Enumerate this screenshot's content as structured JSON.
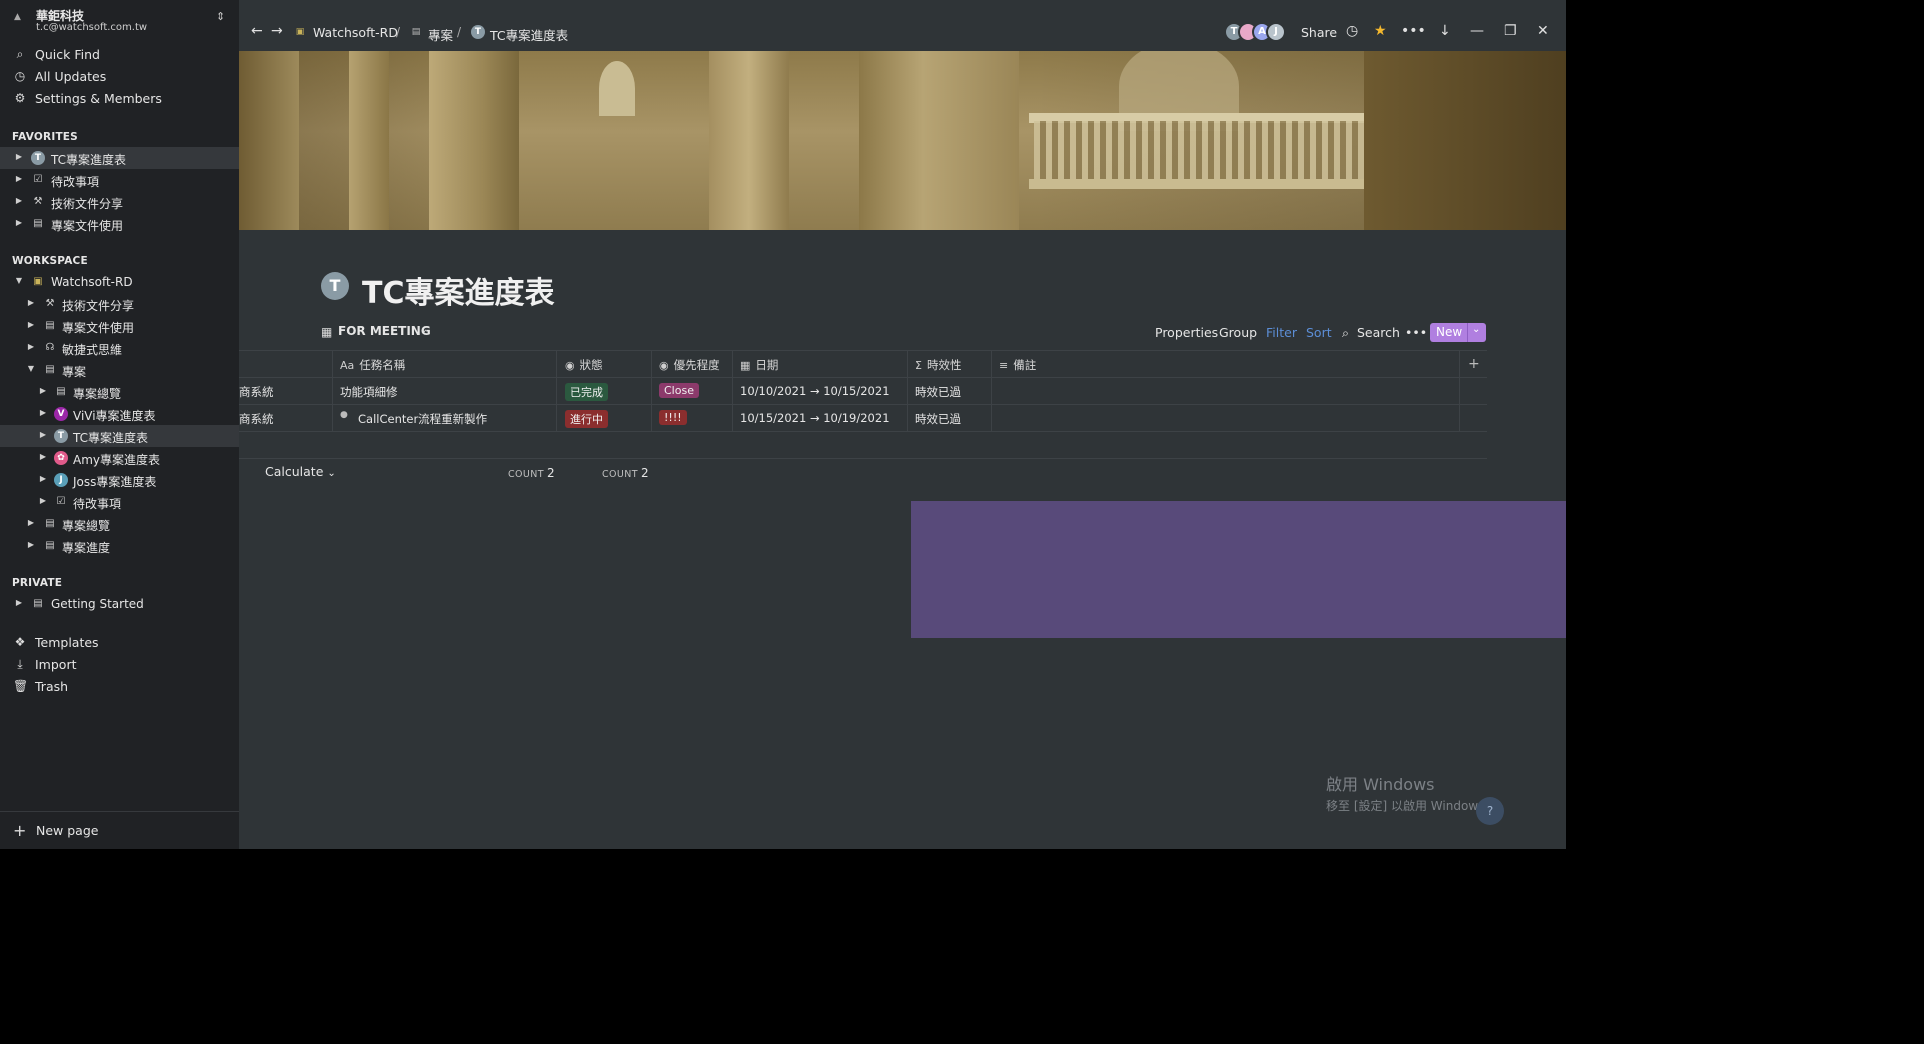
{
  "workspace": {
    "name": "華鉅科技",
    "email": "t.c@watchsoft.com.tw"
  },
  "nav": {
    "quick_find": "Quick Find",
    "all_updates": "All Updates",
    "settings": "Settings & Members"
  },
  "sections": {
    "favorites": "FAVORITES",
    "workspace": "WORKSPACE",
    "private": "PRIVATE"
  },
  "favorites": [
    {
      "label": "TC專案進度表",
      "icon": "T"
    },
    {
      "label": "待改事項",
      "icon": "checkbox-icon"
    },
    {
      "label": "技術文件分享",
      "icon": "tools-icon"
    },
    {
      "label": "專案文件使用",
      "icon": "doc-icon"
    }
  ],
  "workspace_tree": {
    "root": "Watchsoft-RD",
    "items": [
      {
        "label": "技術文件分享"
      },
      {
        "label": "專案文件使用"
      },
      {
        "label": "敏捷式思維"
      },
      {
        "label": "專案"
      },
      {
        "label": "專案總覽"
      },
      {
        "label": "ViVi專案進度表",
        "icon": "V"
      },
      {
        "label": "TC專案進度表",
        "icon": "T"
      },
      {
        "label": "Amy專案進度表"
      },
      {
        "label": "Joss專案進度表",
        "icon": "J"
      },
      {
        "label": "待改事項"
      },
      {
        "label": "專案總覽"
      },
      {
        "label": "專案進度"
      }
    ]
  },
  "private": [
    {
      "label": "Getting Started"
    }
  ],
  "bottom_nav": {
    "templates": "Templates",
    "import": "Import",
    "trash": "Trash",
    "new_page": "New page"
  },
  "breadcrumb": {
    "workspace": "Watchsoft-RD",
    "sep": "/",
    "project": "專案",
    "page": "TC專案進度表"
  },
  "topbar": {
    "share": "Share",
    "avatars": [
      "T",
      "",
      "A",
      "J"
    ]
  },
  "page": {
    "icon": "T",
    "title": "TC專案進度表"
  },
  "view": {
    "name": "FOR MEETING"
  },
  "toolbar": {
    "properties": "Properties",
    "group": "Group",
    "filter": "Filter",
    "sort": "Sort",
    "search": "Search",
    "new": "New"
  },
  "table": {
    "headers": {
      "name": "任務名稱",
      "status": "狀態",
      "priority": "優先程度",
      "date": "日期",
      "timeliness": "時效性",
      "notes": "備註"
    },
    "rows": [
      {
        "project": "商系統",
        "name": "功能項細修",
        "status": "已完成",
        "priority": "Close",
        "date": "10/10/2021 → 10/15/2021",
        "timeliness": "時效已過"
      },
      {
        "project": "商系統",
        "name": "CallCenter流程重新製作",
        "status": "進行中",
        "priority": "!!!!",
        "date": "10/15/2021 → 10/19/2021",
        "timeliness": "時效已過"
      }
    ],
    "footer": {
      "calculate": "Calculate",
      "count_label": "COUNT",
      "count_name": "2",
      "count_status": "2"
    }
  },
  "watermark": {
    "line1": "啟用 Windows",
    "line2": "移至 [設定] 以啟用 Windows。"
  },
  "colors": {
    "accent_new": "#b07fe0",
    "status_done": "#2b593f",
    "status_progress": "#8b2e2e",
    "priority_close": "#8c3a6b",
    "priority_urgent": "#8b2e2e",
    "filter_blue": "#5c8ed6"
  }
}
